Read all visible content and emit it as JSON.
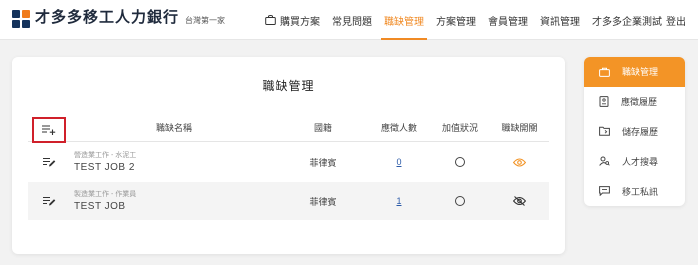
{
  "header": {
    "brand_title": "才多多移工人力銀行",
    "brand_sub": "台灣第一家",
    "nav": [
      {
        "label": "購買方案",
        "icon": "shopping-bag-icon"
      },
      {
        "label": "常見問題"
      },
      {
        "label": "職缺管理",
        "active": true
      },
      {
        "label": "方案管理"
      },
      {
        "label": "會員管理"
      },
      {
        "label": "資訊管理"
      },
      {
        "label": "才多多企業測試"
      },
      {
        "label": "登出"
      }
    ]
  },
  "page": {
    "title": "職缺管理",
    "columns": [
      "職缺名稱",
      "國籍",
      "應徵人數",
      "加值狀況",
      "職缺開關"
    ],
    "rows": [
      {
        "category": "營造業工作 - 水泥工",
        "title": "TEST JOB 2",
        "nationality": "菲律賓",
        "applicants": "0",
        "visibility": "visible"
      },
      {
        "category": "製造業工作 - 作業員",
        "title": "TEST JOB",
        "nationality": "菲律賓",
        "applicants": "1",
        "visibility": "hidden"
      }
    ]
  },
  "sidebar": {
    "items": [
      {
        "label": "職缺管理",
        "icon": "briefcase-icon",
        "active": true
      },
      {
        "label": "應徵履歷",
        "icon": "resume-icon"
      },
      {
        "label": "儲存履歷",
        "icon": "saved-folder-icon"
      },
      {
        "label": "人才搜尋",
        "icon": "talent-search-icon"
      },
      {
        "label": "移工私訊",
        "icon": "message-icon"
      }
    ]
  },
  "colors": {
    "accent": "#f39426",
    "brand_navy": "#14335c",
    "highlight_border": "#d0202a",
    "link": "#2b5aa8"
  }
}
